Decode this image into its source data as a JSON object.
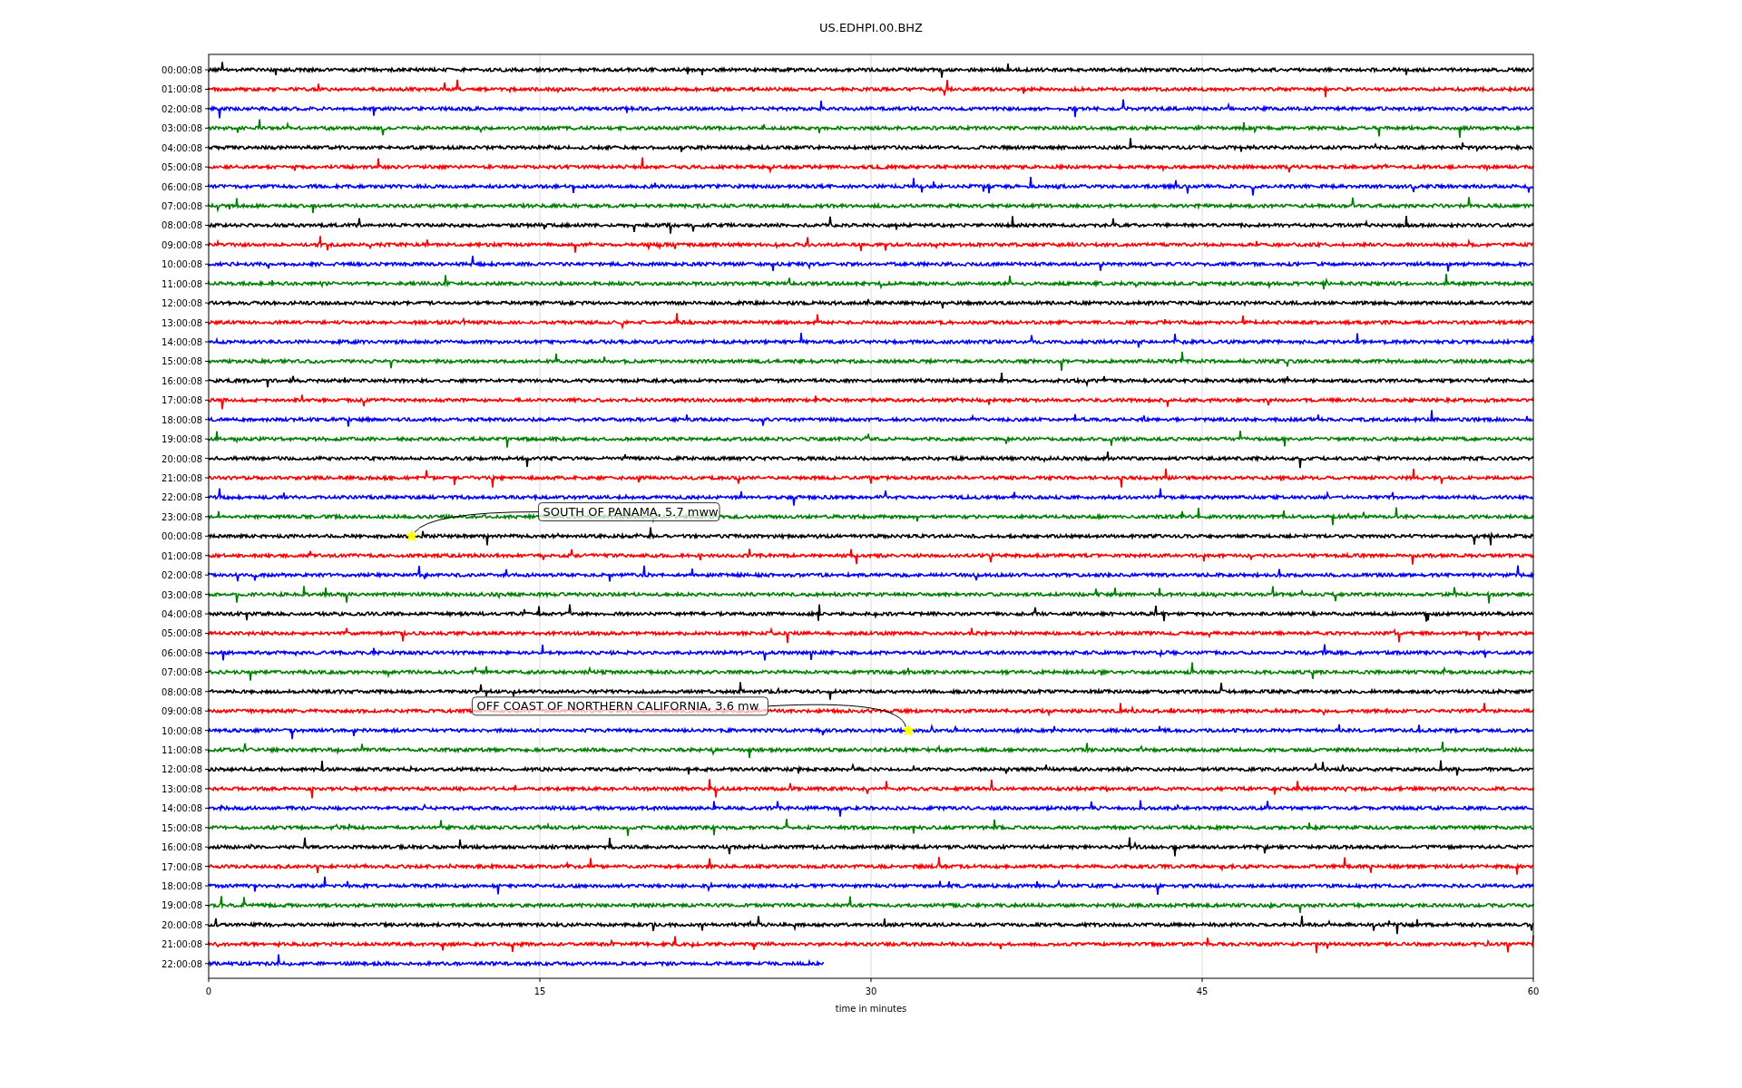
{
  "plot": {
    "title": "US.EDHPI.00.BHZ",
    "xlabel": "time in minutes",
    "xticks": [
      "0",
      "15",
      "30",
      "45",
      "60"
    ],
    "annotations": [
      "SOUTH OF PANAMA, 5.7 mww",
      "OFF COAST OF NORTHERN CALIFORNIA, 3.6 mw"
    ]
  },
  "traces": [
    {
      "label": "00:00:08",
      "color": "#000000",
      "level": 1
    },
    {
      "label": "01:00:08",
      "color": "#ff0000",
      "level": 1
    },
    {
      "label": "02:00:08",
      "color": "#0000ff",
      "level": 1
    },
    {
      "label": "03:00:08",
      "color": "#008000",
      "level": 1
    },
    {
      "label": "04:00:08",
      "color": "#000000",
      "level": 1
    },
    {
      "label": "05:00:08",
      "color": "#ff0000",
      "level": 1
    },
    {
      "label": "06:00:08",
      "color": "#0000ff",
      "level": 1
    },
    {
      "label": "07:00:08",
      "color": "#008000",
      "level": 1
    },
    {
      "label": "08:00:08",
      "color": "#000000",
      "level": 1
    },
    {
      "label": "09:00:08",
      "color": "#ff0000",
      "level": 1
    },
    {
      "label": "10:00:08",
      "color": "#0000ff",
      "level": 1
    },
    {
      "label": "11:00:08",
      "color": "#008000",
      "level": 1
    },
    {
      "label": "12:00:08",
      "color": "#000000",
      "level": 1
    },
    {
      "label": "13:00:08",
      "color": "#ff0000",
      "level": 1
    },
    {
      "label": "14:00:08",
      "color": "#0000ff",
      "level": 1
    },
    {
      "label": "15:00:08",
      "color": "#008000",
      "level": 1
    },
    {
      "label": "16:00:08",
      "color": "#000000",
      "level": 1
    },
    {
      "label": "17:00:08",
      "color": "#ff0000",
      "level": 1
    },
    {
      "label": "18:00:08",
      "color": "#0000ff",
      "level": 1
    },
    {
      "label": "19:00:08",
      "color": "#008000",
      "level": 1
    },
    {
      "label": "20:00:08",
      "color": "#000000",
      "level": 1
    },
    {
      "label": "21:00:08",
      "color": "#ff0000",
      "level": 1
    },
    {
      "label": "22:00:08",
      "color": "#0000ff",
      "level": 1
    },
    {
      "label": "23:00:08",
      "color": "#008000",
      "level": 1
    },
    {
      "label": "00:00:08",
      "color": "#000000",
      "level": 1
    },
    {
      "label": "01:00:08",
      "color": "#ff0000",
      "level": 1
    },
    {
      "label": "02:00:08",
      "color": "#0000ff",
      "level": 1
    },
    {
      "label": "03:00:08",
      "color": "#008000",
      "level": 1
    },
    {
      "label": "04:00:08",
      "color": "#000000",
      "level": 1
    },
    {
      "label": "05:00:08",
      "color": "#ff0000",
      "level": 1
    },
    {
      "label": "06:00:08",
      "color": "#0000ff",
      "level": 1
    },
    {
      "label": "07:00:08",
      "color": "#008000",
      "level": 1
    },
    {
      "label": "08:00:08",
      "color": "#000000",
      "level": 1
    },
    {
      "label": "09:00:08",
      "color": "#ff0000",
      "level": 1
    },
    {
      "label": "10:00:08",
      "color": "#0000ff",
      "level": 1
    },
    {
      "label": "11:00:08",
      "color": "#008000",
      "level": 1
    },
    {
      "label": "12:00:08",
      "color": "#000000",
      "level": 1
    },
    {
      "label": "13:00:08",
      "color": "#ff0000",
      "level": 1
    },
    {
      "label": "14:00:08",
      "color": "#0000ff",
      "level": 1
    },
    {
      "label": "15:00:08",
      "color": "#008000",
      "level": 1
    },
    {
      "label": "16:00:08",
      "color": "#000000",
      "level": 1
    },
    {
      "label": "17:00:08",
      "color": "#ff0000",
      "level": 1
    },
    {
      "label": "18:00:08",
      "color": "#0000ff",
      "level": 1
    },
    {
      "label": "19:00:08",
      "color": "#008000",
      "level": 1
    },
    {
      "label": "20:00:08",
      "color": "#000000",
      "level": 1
    },
    {
      "label": "21:00:08",
      "color": "#ff0000",
      "level": 1
    },
    {
      "label": "22:00:08",
      "color": "#0000ff",
      "level": 0.465
    }
  ]
}
